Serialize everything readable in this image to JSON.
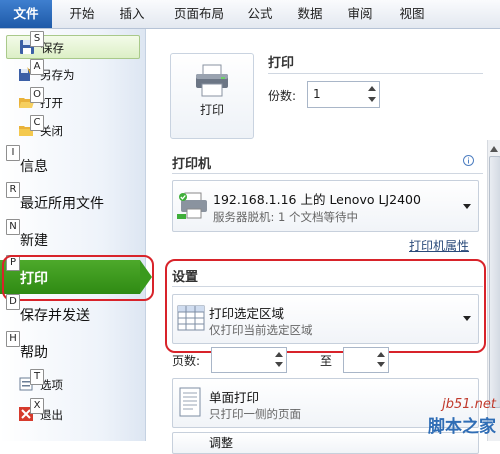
{
  "tabs": [
    "文件",
    "开始",
    "插入",
    "页面布局",
    "公式",
    "数据",
    "审阅",
    "视图"
  ],
  "left_menu": {
    "small_items": [
      {
        "key": "S",
        "label": "保存",
        "icon": "save-icon"
      },
      {
        "key": "A",
        "label": "另存为",
        "icon": "save-as-icon"
      },
      {
        "key": "O",
        "label": "打开",
        "icon": "open-folder-icon"
      },
      {
        "key": "C",
        "label": "关闭",
        "icon": "close-folder-icon"
      }
    ],
    "big_items": [
      {
        "key": "I",
        "label": "信息"
      },
      {
        "key": "R",
        "label": "最近所用文件"
      },
      {
        "key": "N",
        "label": "新建"
      },
      {
        "key": "P",
        "label": "打印"
      },
      {
        "key": "D",
        "label": "保存并发送"
      },
      {
        "key": "H",
        "label": "帮助"
      }
    ],
    "bottom_items": [
      {
        "key": "T",
        "label": "选项",
        "icon": "options-icon"
      },
      {
        "key": "X",
        "label": "退出",
        "icon": "exit-icon"
      }
    ]
  },
  "print": {
    "button_label": "打印",
    "title": "打印",
    "copies_label": "份数:",
    "copies_value": "1"
  },
  "printer": {
    "section_title": "打印机",
    "name": "192.168.1.16 上的 Lenovo LJ2400",
    "status": "服务器脱机: 1 个文档等待中",
    "properties_link": "打印机属性"
  },
  "settings": {
    "section_title": "设置",
    "scope_title": "打印选定区域",
    "scope_desc": "仅打印当前选定区域",
    "pages_label": "页数:",
    "to_label": "至",
    "sides_title": "单面打印",
    "sides_desc": "只打印一侧的页面",
    "collate_partial": "调整"
  },
  "watermark": {
    "site": "jb51.net",
    "text": "脚本之家"
  },
  "colors": {
    "active_green": "#3a9a1d",
    "highlight_red": "#d8232a",
    "file_tab_blue": "#2a66b8"
  }
}
